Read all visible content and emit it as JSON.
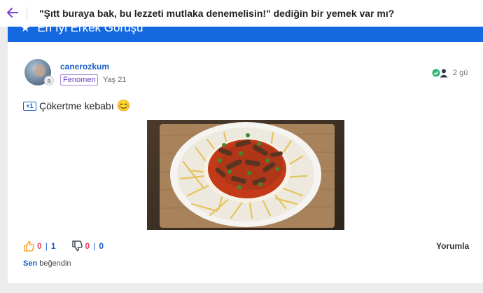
{
  "header": {
    "question_title": "\"Şıtt buraya bak, bu lezzeti mutlaka denemelisin!\" dediğin bir yemek var mı?",
    "back_icon": "back-arrow-icon",
    "accent_color": "#7a3fd6"
  },
  "banner": {
    "label": "En İyi Erkek Görüşü",
    "icon": "star-icon",
    "color": "#1569e0"
  },
  "post": {
    "author": {
      "username": "canerozkum",
      "avatar_badge": "a",
      "role": "Fenomen",
      "age": "Yaş 21"
    },
    "meta": {
      "icon": "verified-user-icon",
      "time": "2 gü"
    },
    "answer": {
      "plus_badge": "+1",
      "text": "Çökertme kebabı",
      "emoji": "😊"
    },
    "image": {
      "icon": "food-photo"
    },
    "reactions": {
      "like_icon": "thumbs-up-icon",
      "like_count": "0",
      "like_total": "1",
      "dislike_icon": "thumbs-down-icon",
      "dislike_count": "0",
      "dislike_total": "0",
      "separator": "|"
    },
    "comment_label": "Yorumla",
    "liked_by": {
      "you": "Sen",
      "rest": "beğendin"
    }
  }
}
